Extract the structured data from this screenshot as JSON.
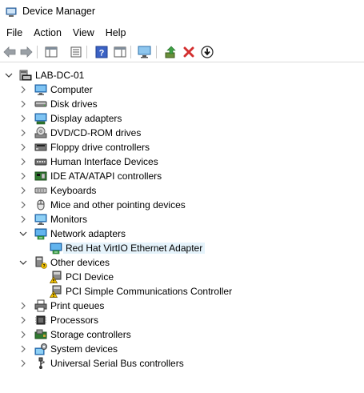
{
  "window": {
    "title": "Device Manager"
  },
  "menu": {
    "items": [
      "File",
      "Action",
      "View",
      "Help"
    ]
  },
  "toolbar": {
    "buttons": [
      "back-icon",
      "forward-icon",
      "show-hide-tree-icon",
      "properties-icon",
      "help-icon",
      "action-pane-icon",
      "monitor-scan-icon",
      "update-driver-icon",
      "uninstall-icon",
      "disable-device-icon"
    ]
  },
  "tree": {
    "root": "LAB-DC-01",
    "categories": [
      {
        "label": "Computer",
        "icon": "computer-icon",
        "expanded": false
      },
      {
        "label": "Disk drives",
        "icon": "disk-drive-icon",
        "expanded": false
      },
      {
        "label": "Display adapters",
        "icon": "display-adapter-icon",
        "expanded": false
      },
      {
        "label": "DVD/CD-ROM drives",
        "icon": "dvd-drive-icon",
        "expanded": false
      },
      {
        "label": "Floppy drive controllers",
        "icon": "floppy-controller-icon",
        "expanded": false
      },
      {
        "label": "Human Interface Devices",
        "icon": "hid-icon",
        "expanded": false
      },
      {
        "label": "IDE ATA/ATAPI controllers",
        "icon": "ide-controller-icon",
        "expanded": false
      },
      {
        "label": "Keyboards",
        "icon": "keyboard-icon",
        "expanded": false
      },
      {
        "label": "Mice and other pointing devices",
        "icon": "mouse-icon",
        "expanded": false
      },
      {
        "label": "Monitors",
        "icon": "monitor-icon",
        "expanded": false
      },
      {
        "label": "Network adapters",
        "icon": "network-adapter-icon",
        "expanded": true,
        "children": [
          {
            "label": "Red Hat VirtIO Ethernet Adapter",
            "icon": "network-adapter-icon",
            "selected": true
          }
        ]
      },
      {
        "label": "Other devices",
        "icon": "other-devices-icon",
        "expanded": true,
        "children": [
          {
            "label": "PCI Device",
            "icon": "warning-device-icon"
          },
          {
            "label": "PCI Simple Communications Controller",
            "icon": "warning-device-icon"
          }
        ]
      },
      {
        "label": "Print queues",
        "icon": "printer-icon",
        "expanded": false
      },
      {
        "label": "Processors",
        "icon": "processor-icon",
        "expanded": false
      },
      {
        "label": "Storage controllers",
        "icon": "storage-controller-icon",
        "expanded": false
      },
      {
        "label": "System devices",
        "icon": "system-devices-icon",
        "expanded": false
      },
      {
        "label": "Universal Serial Bus controllers",
        "icon": "usb-icon",
        "expanded": false
      }
    ]
  },
  "colors": {
    "selection": "#e5f3fb",
    "accent_blue": "#2a8ad4",
    "error_red": "#d32f2f",
    "warning_yellow": "#f5c400"
  }
}
